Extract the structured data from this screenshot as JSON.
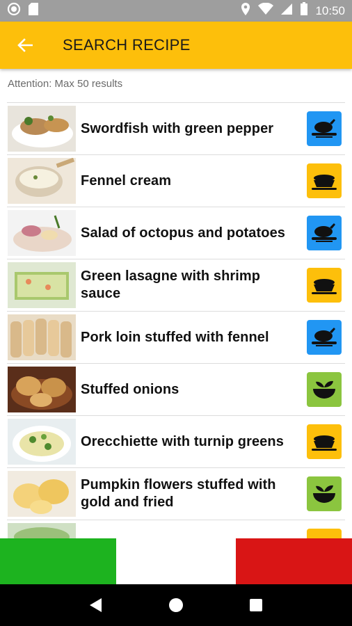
{
  "status_bar": {
    "time": "10:50"
  },
  "app_bar": {
    "title": "SEARCH RECIPE"
  },
  "notice": "Attention: Max 50 results",
  "recipes": [
    {
      "title": "Swordfish with green pepper",
      "category_icon": "roast-chicken-icon",
      "category_color": "#2196f3"
    },
    {
      "title": "Fennel cream",
      "category_icon": "pasta-bowl-icon",
      "category_color": "#fdbf0b"
    },
    {
      "title": "Salad of octopus and potatoes",
      "category_icon": "roast-chicken-icon",
      "category_color": "#2196f3"
    },
    {
      "title": "Green lasagne with shrimp sauce",
      "category_icon": "pasta-bowl-icon",
      "category_color": "#fdbf0b"
    },
    {
      "title": "Pork loin stuffed with fennel",
      "category_icon": "roast-chicken-icon",
      "category_color": "#2196f3"
    },
    {
      "title": "Stuffed onions",
      "category_icon": "salad-bowl-icon",
      "category_color": "#8bc53f"
    },
    {
      "title": "Orecchiette with turnip greens",
      "category_icon": "pasta-bowl-icon",
      "category_color": "#fdbf0b"
    },
    {
      "title": "Pumpkin flowers stuffed with gold and fried",
      "category_icon": "salad-bowl-icon",
      "category_color": "#8bc53f"
    },
    {
      "title": "",
      "category_icon": "pasta-bowl-icon",
      "category_color": "#fdbf0b"
    }
  ],
  "flag_colors": [
    "#1db31f",
    "#ffffff",
    "#d91515"
  ],
  "colors": {
    "accent": "#fdbf0b",
    "status_bar": "#9e9e9e",
    "nav_bar": "#000000"
  }
}
